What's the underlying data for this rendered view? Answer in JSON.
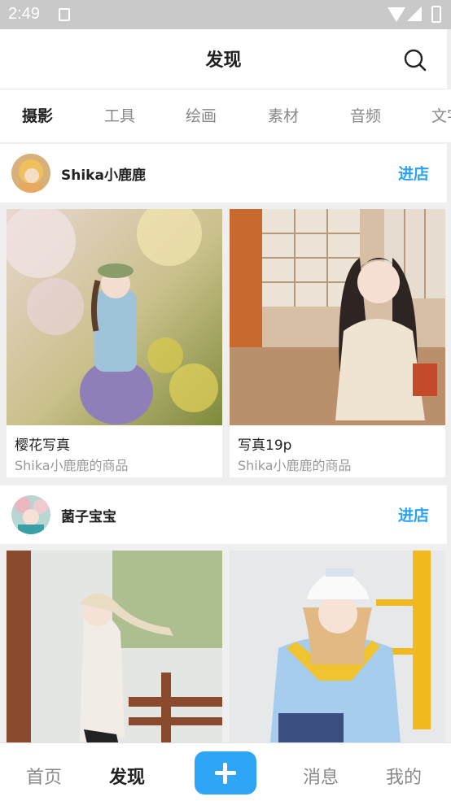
{
  "status_bar": {
    "time": "2:49"
  },
  "header": {
    "title": "发现"
  },
  "tabs": [
    {
      "label": "摄影",
      "active": true
    },
    {
      "label": "工具"
    },
    {
      "label": "绘画"
    },
    {
      "label": "素材"
    },
    {
      "label": "音频"
    },
    {
      "label": "文字"
    }
  ],
  "shops": [
    {
      "name": "Shika小鹿鹿",
      "enter_label": "进店",
      "products": [
        {
          "title": "樱花写真",
          "subtitle": "Shika小鹿鹿的商品"
        },
        {
          "title": "写真19p",
          "subtitle": "Shika小鹿鹿的商品"
        }
      ]
    },
    {
      "name": "菌子宝宝",
      "enter_label": "进店",
      "products": [
        {
          "title": "",
          "subtitle": ""
        },
        {
          "title": "",
          "subtitle": ""
        }
      ]
    }
  ],
  "bottom_nav": {
    "home": "首页",
    "discover": "发现",
    "messages": "消息",
    "mine": "我的"
  },
  "colors": {
    "accent": "#2ea6f5",
    "enter_text": "#2aa2f2"
  }
}
